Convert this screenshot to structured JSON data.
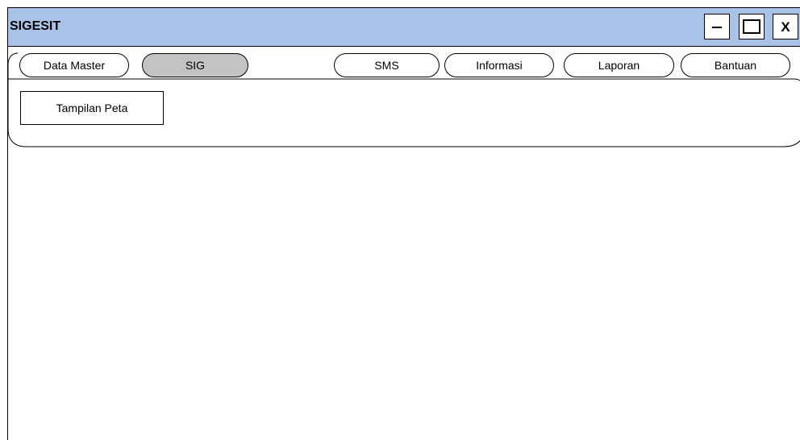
{
  "window": {
    "title": "SIGESIT",
    "titlebar_color": "#a9c3e8",
    "controls": {
      "minimize_icon": "minimize-icon",
      "maximize_icon": "maximize-icon",
      "close_label": "X"
    }
  },
  "menu": {
    "tabs": [
      {
        "label": "Data Master",
        "active": false
      },
      {
        "label": "SIG",
        "active": true
      },
      {
        "label": "SMS",
        "active": false
      },
      {
        "label": "Informasi",
        "active": false
      },
      {
        "label": "Laporan",
        "active": false
      },
      {
        "label": "Bantuan",
        "active": false
      }
    ],
    "active_tab_color": "#c3c3c3",
    "submenu": {
      "items": [
        {
          "label": "Tampilan Peta"
        }
      ]
    }
  }
}
